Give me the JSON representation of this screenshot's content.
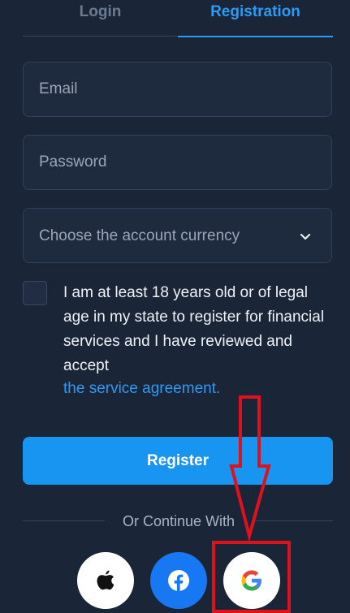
{
  "tabs": {
    "login": "Login",
    "registration": "Registration",
    "active": "registration"
  },
  "form": {
    "email_placeholder": "Email",
    "password_placeholder": "Password",
    "currency_placeholder": "Choose the account currency",
    "terms_text": "I am at least 18 years old or of legal age in my state to register for financial services and I have reviewed and accept",
    "terms_link": "the service agreement.",
    "register_label": "Register"
  },
  "divider_text": "Or Continue With",
  "social": {
    "apple": "apple-icon",
    "facebook": "facebook-icon",
    "google": "google-icon"
  },
  "colors": {
    "background": "#1b2538",
    "accent": "#2b9bf4",
    "button": "#1795f0",
    "annotation": "#e0111b"
  }
}
